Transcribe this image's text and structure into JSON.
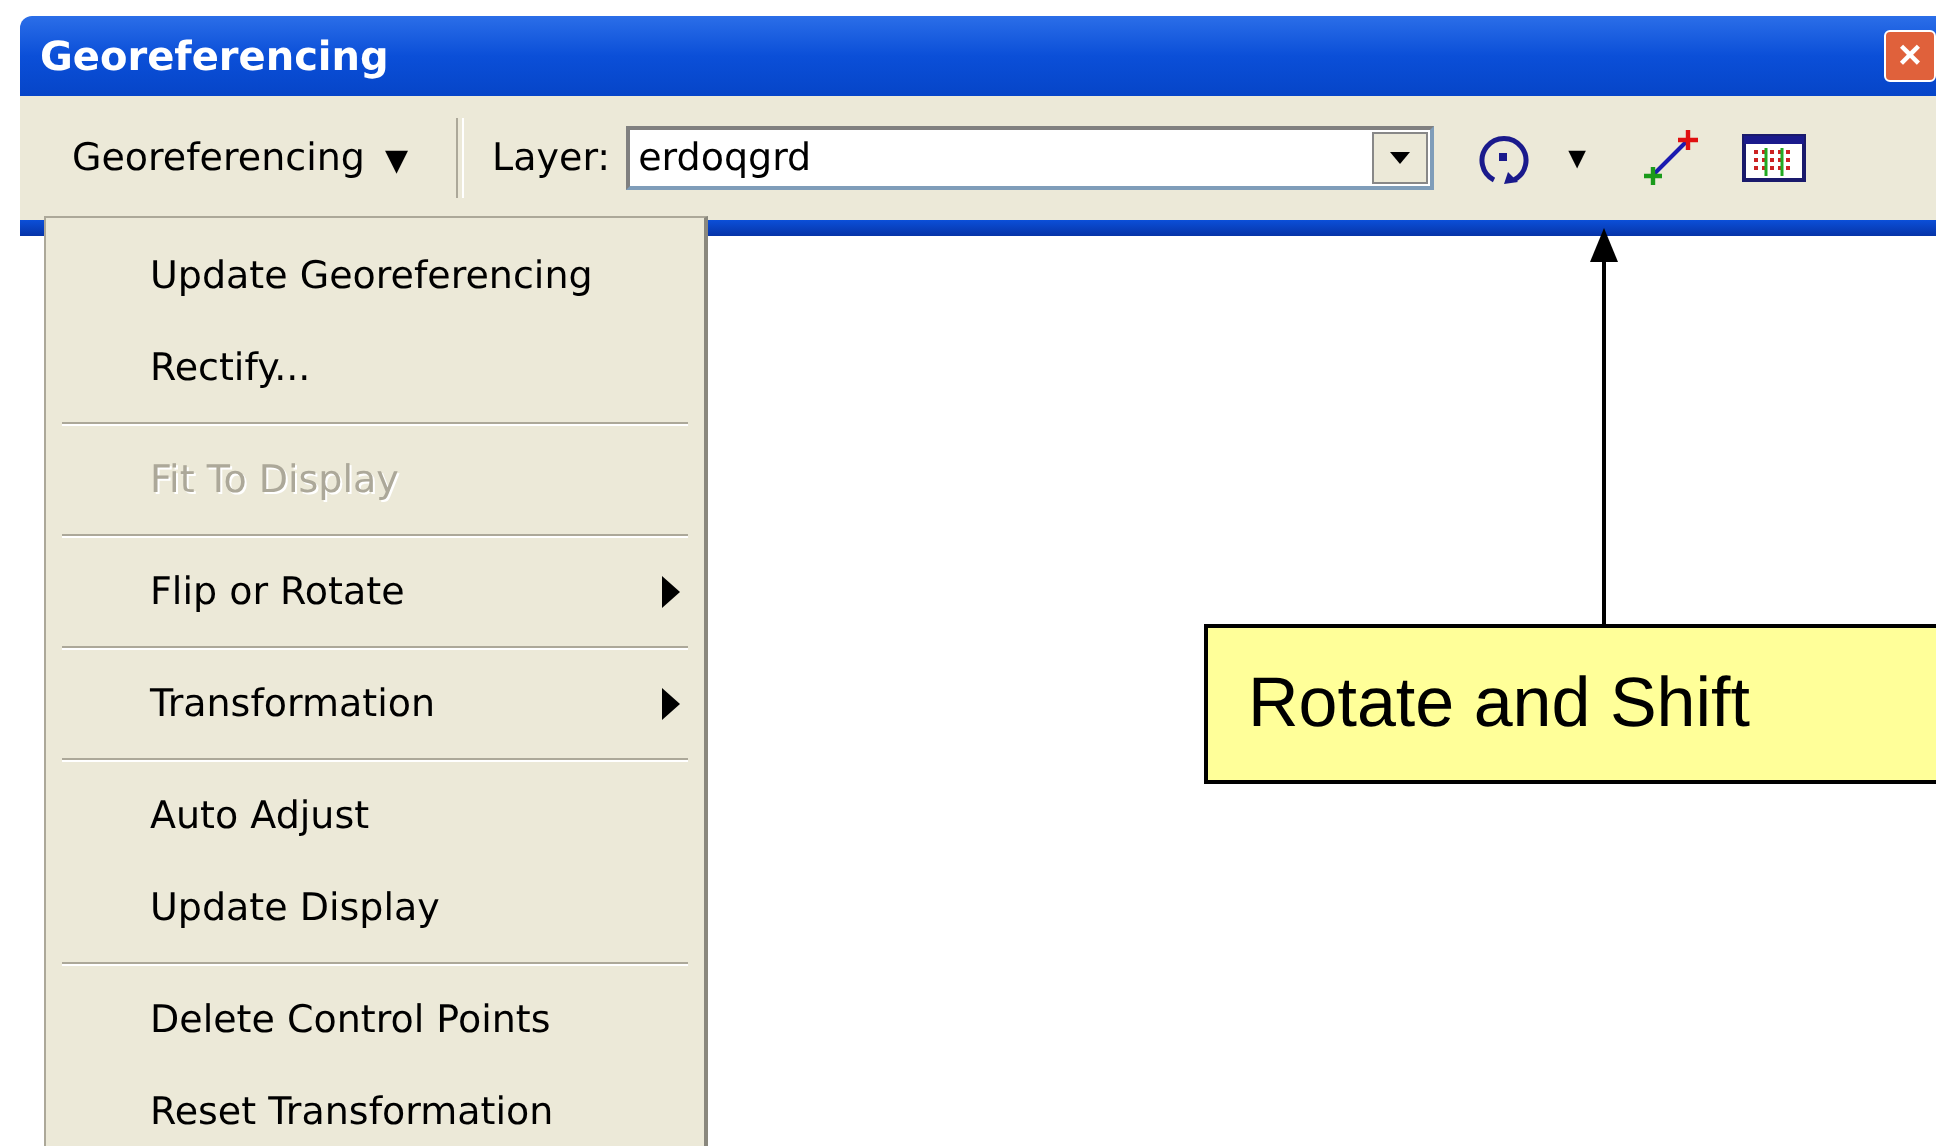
{
  "window": {
    "title": "Georeferencing",
    "close_label": "×"
  },
  "toolbar": {
    "menu_button": {
      "label": "Georeferencing",
      "arrow": "▼"
    },
    "layer_label": "Layer:",
    "layer_value": "erdoqgrd",
    "rotate_arrow": "▼"
  },
  "menu": {
    "items": [
      {
        "kind": "item",
        "label": "Update Georeferencing",
        "disabled": false,
        "submenu": false
      },
      {
        "kind": "item",
        "label": "Rectify...",
        "disabled": false,
        "submenu": false
      },
      {
        "kind": "separator"
      },
      {
        "kind": "item",
        "label": "Fit To Display",
        "disabled": true,
        "submenu": false
      },
      {
        "kind": "separator"
      },
      {
        "kind": "item",
        "label": "Flip or Rotate",
        "disabled": false,
        "submenu": true
      },
      {
        "kind": "separator"
      },
      {
        "kind": "item",
        "label": "Transformation",
        "disabled": false,
        "submenu": true
      },
      {
        "kind": "separator"
      },
      {
        "kind": "item",
        "label": "Auto Adjust",
        "disabled": false,
        "submenu": false
      },
      {
        "kind": "item",
        "label": "Update Display",
        "disabled": false,
        "submenu": false
      },
      {
        "kind": "separator"
      },
      {
        "kind": "item",
        "label": "Delete Control Points",
        "disabled": false,
        "submenu": false
      },
      {
        "kind": "item",
        "label": "Reset Transformation",
        "disabled": false,
        "submenu": false
      }
    ]
  },
  "callout": {
    "text": "Rotate and Shift"
  }
}
